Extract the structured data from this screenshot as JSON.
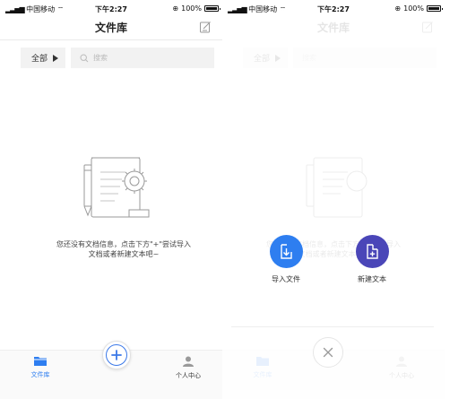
{
  "status_bar": {
    "carrier": "中国移动",
    "time": "下午2:27",
    "battery": "100%"
  },
  "header": {
    "title": "文件库",
    "edit_icon": "edit-square-icon"
  },
  "filter": {
    "category": "全部",
    "search_placeholder": "搜索"
  },
  "empty_state": {
    "line1": "您还没有文档信息，点击下方\"+\"尝试导入",
    "line2": "文档或者新建文本吧~",
    "illustration": "document-gear-illustration"
  },
  "tabs": [
    {
      "label": "文件库",
      "icon": "folder-icon",
      "active": true
    },
    {
      "label": "个人中心",
      "icon": "user-icon",
      "active": false
    }
  ],
  "fab": {
    "icon": "plus-icon"
  },
  "action_menu": {
    "import": {
      "label": "导入文件",
      "icon": "import-icon",
      "color": "#2e7ef0"
    },
    "new_text": {
      "label": "新建文本",
      "icon": "new-doc-icon",
      "color": "#4a46b8"
    },
    "close_icon": "close-icon"
  },
  "colors": {
    "accent": "#3a78e8",
    "tab_active": "#2e7ef0",
    "tab_inactive": "#999999",
    "filter_bg": "#f2f2f2"
  }
}
